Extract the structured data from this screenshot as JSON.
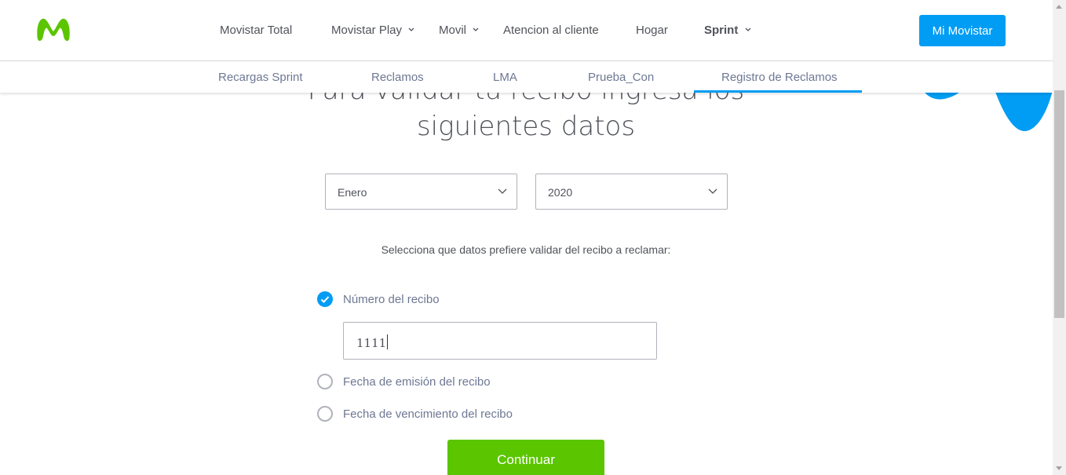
{
  "header": {
    "nav": [
      {
        "label": "Movistar Total",
        "dropdown": false
      },
      {
        "label": "Movistar Play",
        "dropdown": true
      },
      {
        "label": "Movil",
        "dropdown": true
      },
      {
        "label": "Atencion al cliente",
        "dropdown": false
      },
      {
        "label": "Hogar",
        "dropdown": false
      },
      {
        "label": "Sprint",
        "dropdown": true,
        "active": true
      }
    ],
    "cta_label": "Mi Movistar"
  },
  "subnav": {
    "items": [
      "Recargas Sprint",
      "Reclamos",
      "LMA",
      "Prueba_Con",
      "Registro de Reclamos"
    ],
    "active": "Registro de Reclamos"
  },
  "form": {
    "heading_line1": "Para validar tu recibo ingresa los",
    "heading_line2": "siguientes datos",
    "month_select": {
      "value": "Enero"
    },
    "year_select": {
      "value": "2020"
    },
    "instructions": "Selecciona que datos prefiere validar del recibo a reclamar:",
    "options": [
      {
        "label": "Número del recibo",
        "checked": true
      },
      {
        "label": "Fecha de emisión del recibo",
        "checked": false
      },
      {
        "label": "Fecha de vencimiento del recibo",
        "checked": false
      }
    ],
    "recibo_input_value": "1111",
    "submit_label": "Continuar"
  },
  "colors": {
    "brand_blue": "#019df4",
    "brand_green": "#5bc500",
    "text": "#50535a"
  }
}
